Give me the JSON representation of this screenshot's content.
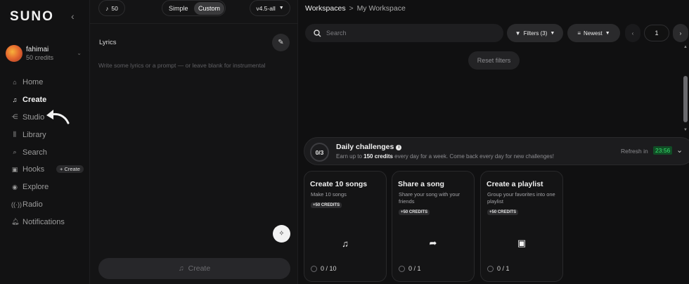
{
  "sidebar": {
    "logo": "SUNO",
    "user": {
      "name": "fahimai",
      "credits": "50 credits"
    },
    "items": [
      {
        "label": "Home",
        "icon": "home-icon",
        "active": false
      },
      {
        "label": "Create",
        "icon": "music-note-icon",
        "active": true
      },
      {
        "label": "Studio",
        "icon": "studio-icon",
        "active": false
      },
      {
        "label": "Library",
        "icon": "library-icon",
        "active": false
      },
      {
        "label": "Search",
        "icon": "search-icon",
        "active": false
      },
      {
        "label": "Hooks",
        "icon": "hooks-icon",
        "active": false,
        "badge": "+ Create"
      },
      {
        "label": "Explore",
        "icon": "explore-icon",
        "active": false
      },
      {
        "label": "Radio",
        "icon": "radio-icon",
        "active": false
      },
      {
        "label": "Notifications",
        "icon": "bell-icon",
        "active": false
      }
    ]
  },
  "create_panel": {
    "credits_pill": "50",
    "mode_simple": "Simple",
    "mode_custom": "Custom",
    "model": "v4.5-all",
    "lyrics_label": "Lyrics",
    "lyrics_placeholder": "Write some lyrics or a prompt — or leave blank for instrumental",
    "create_button": "Create"
  },
  "workspace": {
    "breadcrumb_root": "Workspaces",
    "breadcrumb_sep": ">",
    "breadcrumb_current": "My Workspace",
    "search_placeholder": "Search",
    "filters": "Filters (3)",
    "sort": "Newest",
    "page": "1",
    "reset_filters": "Reset filters"
  },
  "daily": {
    "progress": "0/3",
    "title": "Daily challenges",
    "sub_pre": "Earn up to ",
    "sub_bold": "150 credits",
    "sub_post": " every day for a week. Come back every day for new challenges!",
    "refresh_label": "Refresh in",
    "timer": "23:56"
  },
  "challenges": [
    {
      "title": "Create 10 songs",
      "desc": "Make 10 songs",
      "reward": "+50 CREDITS",
      "icon": "music-note-icon",
      "progress": "0 / 10"
    },
    {
      "title": "Share a song",
      "desc": "Share your song with your friends",
      "reward": "+50 CREDITS",
      "icon": "share-icon",
      "progress": "0 / 1"
    },
    {
      "title": "Create a playlist",
      "desc": "Group your favorites into one playlist",
      "reward": "+50 CREDITS",
      "icon": "playlist-icon",
      "progress": "0 / 1"
    }
  ],
  "colors": {
    "background": "#0f0f10",
    "timer_text": "#35e06b",
    "timer_bg": "#114d26"
  }
}
